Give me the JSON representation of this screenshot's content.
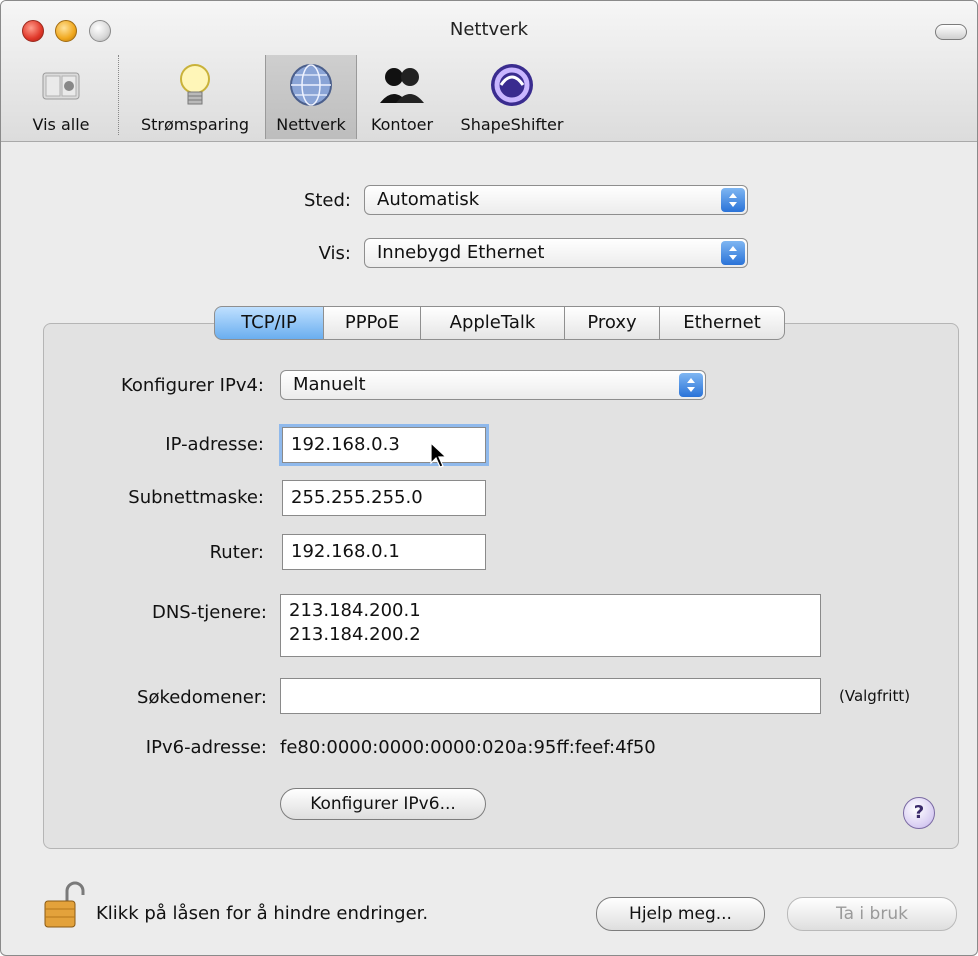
{
  "window": {
    "title": "Nettverk"
  },
  "toolbar": {
    "items": [
      {
        "label": "Vis alle"
      },
      {
        "label": "Strømsparing"
      },
      {
        "label": "Nettverk"
      },
      {
        "label": "Kontoer"
      },
      {
        "label": "ShapeShifter"
      }
    ]
  },
  "location": {
    "label": "Sted:",
    "value": "Automatisk"
  },
  "show": {
    "label": "Vis:",
    "value": "Innebygd Ethernet"
  },
  "tabs": [
    {
      "label": "TCP/IP",
      "active": true
    },
    {
      "label": "PPPoE"
    },
    {
      "label": "AppleTalk"
    },
    {
      "label": "Proxy"
    },
    {
      "label": "Ethernet"
    }
  ],
  "form": {
    "configure_ipv4": {
      "label": "Konfigurer IPv4:",
      "value": "Manuelt"
    },
    "ip_address": {
      "label": "IP-adresse:",
      "value": "192.168.0.3"
    },
    "subnet_mask": {
      "label": "Subnettmaske:",
      "value": "255.255.255.0"
    },
    "router": {
      "label": "Ruter:",
      "value": "192.168.0.1"
    },
    "dns": {
      "label": "DNS-tjenere:",
      "values": [
        "213.184.200.1",
        "213.184.200.2"
      ]
    },
    "search_domains": {
      "label": "Søkedomener:",
      "value": "",
      "hint": "(Valgfritt)"
    },
    "ipv6": {
      "label": "IPv6-adresse:",
      "value": "fe80:0000:0000:0000:020a:95ff:feef:4f50"
    },
    "configure_ipv6_button": "Konfigurer IPv6..."
  },
  "help": {
    "symbol": "?"
  },
  "footer": {
    "lock_text": "Klikk på låsen for å hindre endringer.",
    "assist_button": "Hjelp meg...",
    "apply_button": "Ta i bruk"
  }
}
